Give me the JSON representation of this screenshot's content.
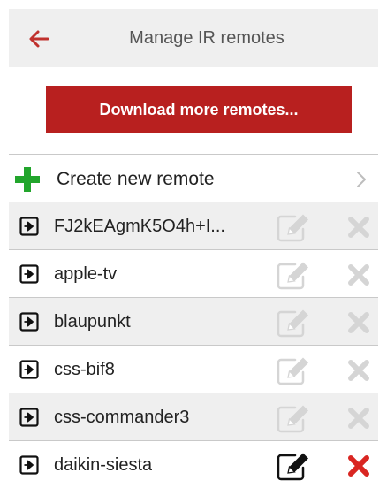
{
  "header": {
    "title": "Manage IR remotes",
    "back_icon": "arrow-left-icon"
  },
  "download_button": {
    "label": "Download more remotes..."
  },
  "create_row": {
    "label": "Create new remote",
    "icon": "plus-icon"
  },
  "remotes": [
    {
      "name": "FJ2kEAgmK5O4h+I...",
      "active": false
    },
    {
      "name": "apple-tv",
      "active": false
    },
    {
      "name": "blaupunkt",
      "active": false
    },
    {
      "name": "css-bif8",
      "active": false
    },
    {
      "name": "css-commander3",
      "active": false
    },
    {
      "name": "daikin-siesta",
      "active": true
    }
  ],
  "colors": {
    "accent_red": "#b8201f",
    "plus_green": "#22a52c",
    "delete_active": "#d92622",
    "icon_disabled": "#d5d5d5",
    "header_bg": "#efefef"
  }
}
